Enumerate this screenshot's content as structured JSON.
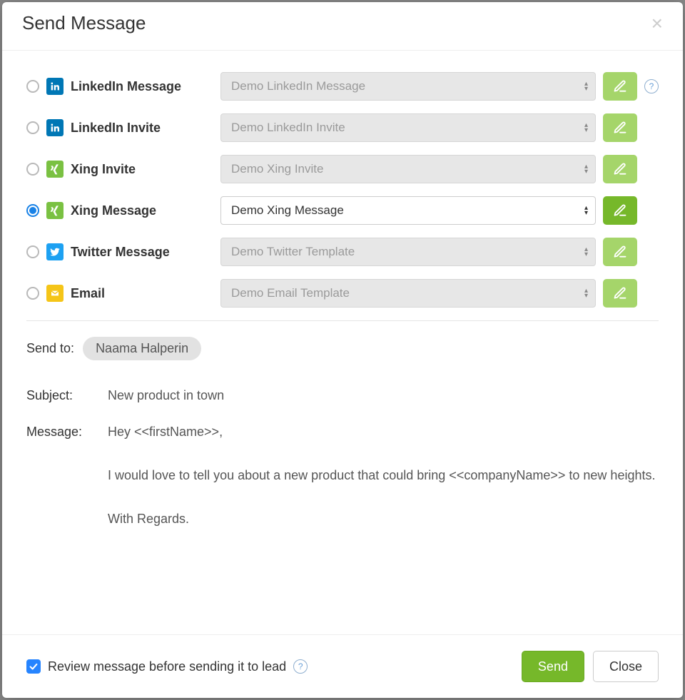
{
  "modal": {
    "title": "Send Message",
    "channels": [
      {
        "id": "linkedin-message",
        "label": "LinkedIn Message",
        "template": "Demo LinkedIn Message",
        "selected": false,
        "icon": "linkedin",
        "help": true
      },
      {
        "id": "linkedin-invite",
        "label": "LinkedIn Invite",
        "template": "Demo LinkedIn Invite",
        "selected": false,
        "icon": "linkedin",
        "help": false
      },
      {
        "id": "xing-invite",
        "label": "Xing Invite",
        "template": "Demo Xing Invite",
        "selected": false,
        "icon": "xing",
        "help": false
      },
      {
        "id": "xing-message",
        "label": "Xing Message",
        "template": "Demo Xing Message",
        "selected": true,
        "icon": "xing",
        "help": false
      },
      {
        "id": "twitter-message",
        "label": "Twitter Message",
        "template": "Demo Twitter Template",
        "selected": false,
        "icon": "twitter",
        "help": false
      },
      {
        "id": "email",
        "label": "Email",
        "template": "Demo Email Template",
        "selected": false,
        "icon": "email",
        "help": false
      }
    ],
    "send_to_label": "Send to:",
    "recipient": "Naama Halperin",
    "subject_label": "Subject:",
    "subject_value": "New product in town",
    "message_label": "Message:",
    "message_value": "Hey <<firstName>>,\n\nI would love to tell you about a new product that could bring <<companyName>> to new heights.\n\nWith Regards.",
    "review_label": "Review message before sending it to lead",
    "review_checked": true,
    "send_button": "Send",
    "close_button": "Close"
  },
  "icons": {
    "linkedin": {
      "bg": "#0077b5",
      "fg": "#ffffff"
    },
    "xing": {
      "bg": "#7ac142",
      "fg": "#ffffff"
    },
    "twitter": {
      "bg": "#1da1f2",
      "fg": "#ffffff"
    },
    "email": {
      "bg": "#f5c518",
      "fg": "#ffffff"
    }
  }
}
